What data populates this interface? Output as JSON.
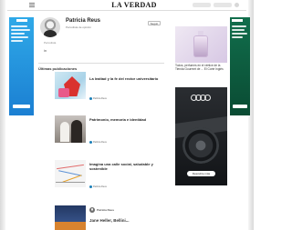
{
  "header": {
    "logo": "LA VERDAD",
    "actions": [
      "",
      ""
    ]
  },
  "profile": {
    "name": "Patricia Reus",
    "role": "Periodista de opinión",
    "follow_label": "Seguir",
    "link_text": "Periodista",
    "social": "in"
  },
  "section": {
    "title": "Últimas publicaciones"
  },
  "articles": [
    {
      "date": "",
      "kicker": "",
      "title": "La lealtad y la fe del rector universitario",
      "author": "Patricia Reus"
    },
    {
      "date": "",
      "kicker": "",
      "title": "Patrimonio, memoria e identidad",
      "author": "Patricia Reus"
    },
    {
      "date": "",
      "kicker": "",
      "title": "Imagina una calle social, saludable y sostenible",
      "author": "Patricia Reus"
    },
    {
      "date": "",
      "kicker": "",
      "title": "",
      "author": "Patricia Reus",
      "quote": "Jane Heller, Bellini..."
    }
  ],
  "sidebar": {
    "ad1_caption": "Todos, perfumes en el vértice de la Tienda Gourmet de ... El Corte Inglés",
    "ad2_label": "",
    "ad2_cta": "Descubre más"
  },
  "ads": {
    "left_color": "#2fa9e8",
    "right_color": "#116e4c"
  }
}
